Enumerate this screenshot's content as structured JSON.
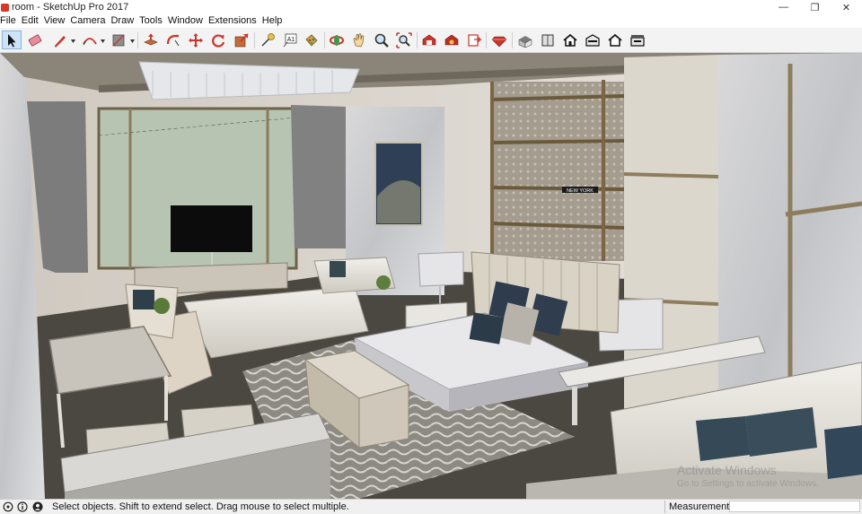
{
  "window": {
    "title": "room - SketchUp Pro 2017",
    "controls": {
      "minimize": "—",
      "maximize": "❐",
      "close": "✕"
    }
  },
  "menubar": {
    "items": [
      {
        "label": "File"
      },
      {
        "label": "Edit"
      },
      {
        "label": "View"
      },
      {
        "label": "Camera"
      },
      {
        "label": "Draw"
      },
      {
        "label": "Tools"
      },
      {
        "label": "Window"
      },
      {
        "label": "Extensions"
      },
      {
        "label": "Help"
      }
    ]
  },
  "toolbar": {
    "active_tool": "select",
    "tools": [
      "select",
      "eraser",
      "line",
      "arc",
      "shape",
      "push-pull",
      "follow-me",
      "move",
      "rotate",
      "scale",
      "tape-measure",
      "text",
      "paint-bucket",
      "orbit",
      "pan",
      "zoom",
      "zoom-extents",
      "3d-warehouse",
      "extension-warehouse",
      "layout",
      "extension-manager",
      "ruby",
      "iso",
      "top",
      "front",
      "right",
      "back",
      "left"
    ],
    "text_tool_glyph": "A1"
  },
  "viewport": {
    "sign_text": "NEW YORK",
    "watermark": {
      "title": "Activate Windows",
      "subtitle": "Go to Settings to activate Windows."
    }
  },
  "statusbar": {
    "hint": "Select objects. Shift to extend select. Drag mouse to select multiple.",
    "measurements_label": "Measurements",
    "measurements_value": ""
  },
  "colors": {
    "toolbar_bg": "#f3f3f3",
    "viewport_wall": "#cfc9c0",
    "floor": "#4b4741",
    "accent_red": "#d53a27"
  }
}
